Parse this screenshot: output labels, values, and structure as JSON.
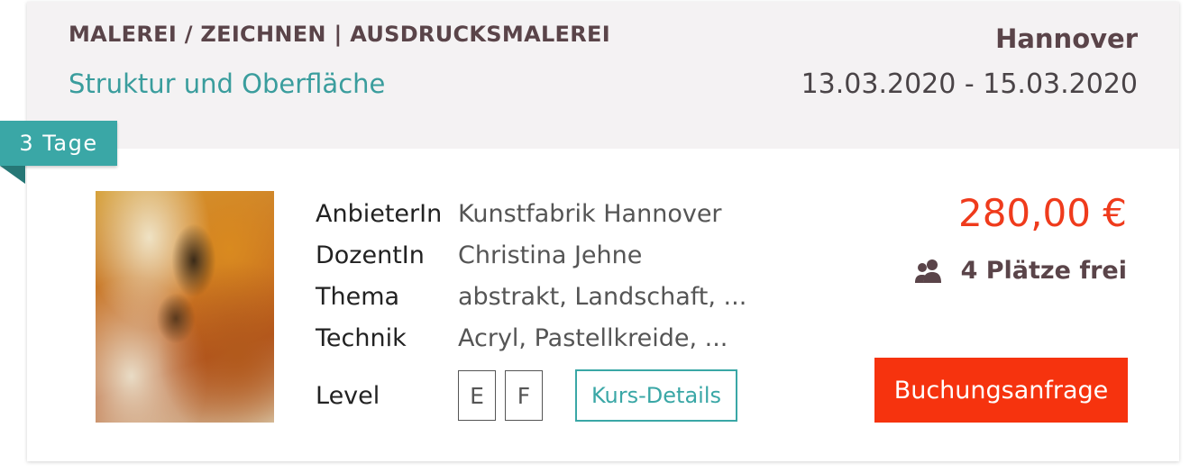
{
  "card": {
    "category": "MALEREI / ZEICHNEN | AUSDRUCKSMALEREI",
    "title": "Struktur und Oberfläche",
    "city": "Hannover",
    "dates": "13.03.2020 - 15.03.2020",
    "duration_badge": "3 Tage",
    "image": {
      "alt": "abstract painting",
      "colors": [
        "#d6a13a",
        "#c46a22",
        "#3a2a18",
        "#e9dcc6"
      ]
    },
    "details": [
      {
        "label": "AnbieterIn",
        "value": "Kunstfabrik Hannover"
      },
      {
        "label": "DozentIn",
        "value": "Christina Jehne"
      },
      {
        "label": "Thema",
        "value": "abstrakt, Landschaft, ..."
      },
      {
        "label": "Technik",
        "value": "Acryl, Pastellkreide, ..."
      }
    ],
    "level": {
      "label": "Level",
      "badges": [
        "E",
        "F"
      ]
    },
    "details_button": "Kurs-Details",
    "price": "280,00 €",
    "seats": {
      "icon": "group-icon",
      "text": "4 Plätze frei"
    },
    "booking_button": "Buchungsanfrage",
    "colors": {
      "accent": "#3aa7a6",
      "price": "#ef3b1c",
      "cta": "#f6330e",
      "heading": "#5a4449"
    }
  }
}
